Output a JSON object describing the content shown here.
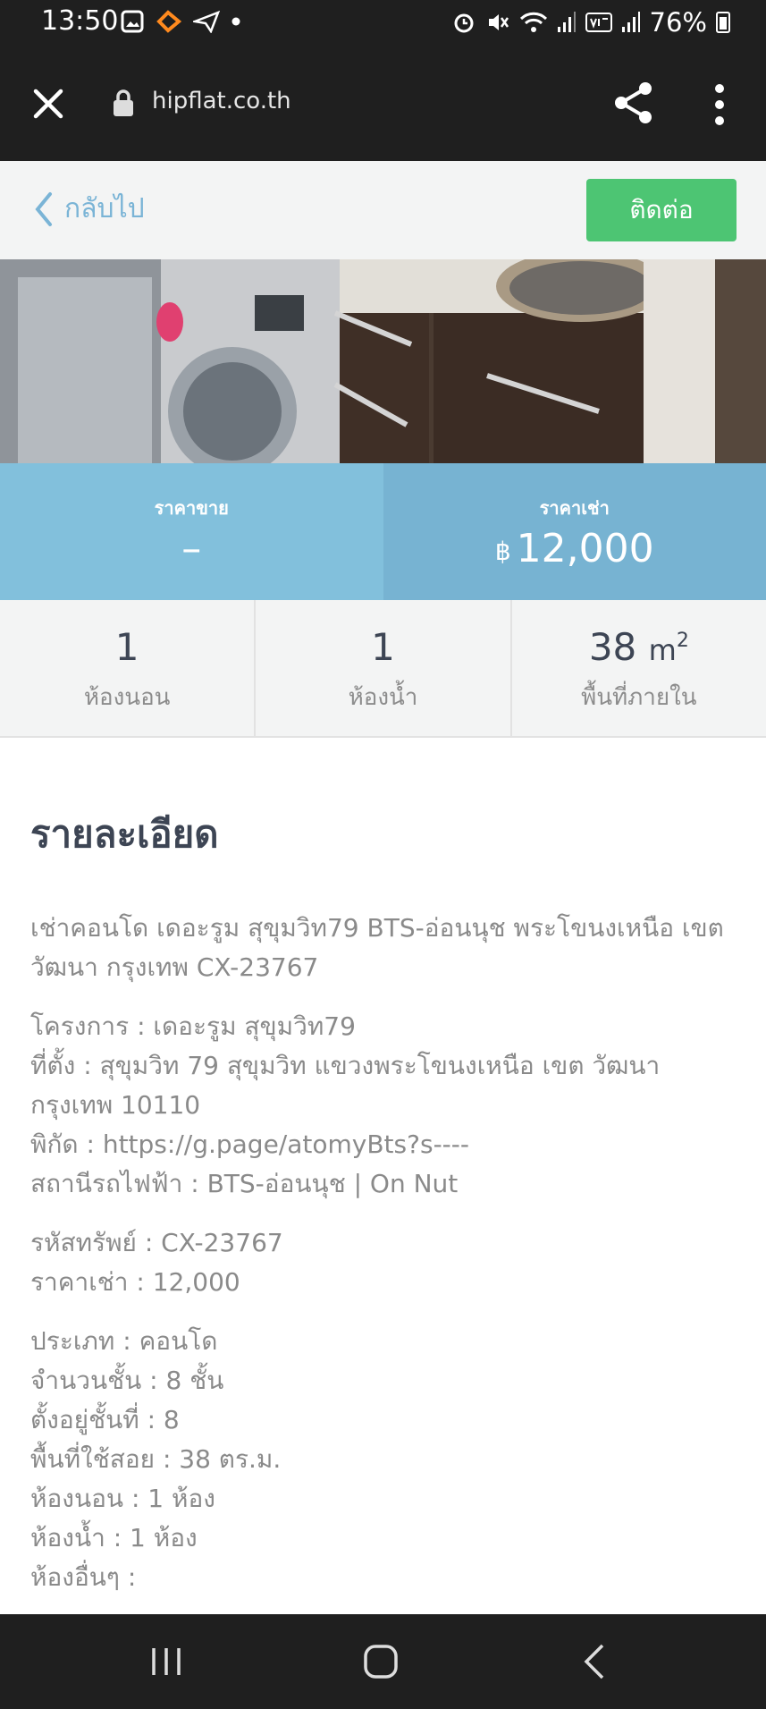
{
  "status_bar": {
    "time": "13:50",
    "battery": "76%",
    "left_icons": [
      "gallery-icon",
      "app-icon",
      "send-icon",
      "dot-icon"
    ],
    "right_icons": [
      "alarm-icon",
      "mute-icon",
      "wifi-icon",
      "signal-icon",
      "volte-icon",
      "signal-icon",
      "battery-icon"
    ]
  },
  "browser": {
    "url": "hipflat.co.th"
  },
  "header": {
    "back_label": "กลับไป",
    "contact_label": "ติดต่อ"
  },
  "prices": {
    "sale_label": "ราคาขาย",
    "sale_value": "–",
    "rent_label": "ราคาเช่า",
    "rent_currency": "฿",
    "rent_value": "12,000"
  },
  "stats": {
    "bedrooms_value": "1",
    "bedrooms_label": "ห้องนอน",
    "bathrooms_value": "1",
    "bathrooms_label": "ห้องน้ำ",
    "area_value": "38",
    "area_unit": "m",
    "area_exp": "2",
    "area_label": "พื้นที่ภายใน"
  },
  "details": {
    "title": "รายละเอียด",
    "intro": "เช่าคอนโด เดอะรูม สุขุมวิท79 BTS-อ่อนนุช พระโขนงเหนือ เขต วัฒนา กรุงเทพ CX-23767",
    "project": "โครงการ : เดอะรูม สุขุมวิท79",
    "location": "ที่ตั้ง : สุขุมวิท 79 สุขุมวิท แขวงพระโขนงเหนือ เขต วัฒนา กรุงเทพ 10110",
    "coordinates": "พิกัด : https://g.page/atomyBts?s----",
    "station": "สถานีรถไฟฟ้า : BTS-อ่อนนุช | On Nut",
    "code": "รหัสทรัพย์ : CX-23767",
    "rent_price": "ราคาเช่า : 12,000",
    "type": "ประเภท : คอนโด",
    "floors": "จำนวนชั้น : 8 ชั้น",
    "on_floor": "ตั้งอยู่ชั้นที่ : 8",
    "usable_area": "พื้นที่ใช้สอย : 38 ตร.ม.",
    "bedrooms": "ห้องนอน : 1 ห้อง",
    "bathrooms": "ห้องน้ำ : 1 ห้อง",
    "other_rooms": "ห้องอื่นๆ :"
  },
  "colors": {
    "contact_green": "#4dc573",
    "price_blue": "#82c0dc",
    "link_blue": "#7ab4d6",
    "dark_bar": "#1f1f1f"
  }
}
